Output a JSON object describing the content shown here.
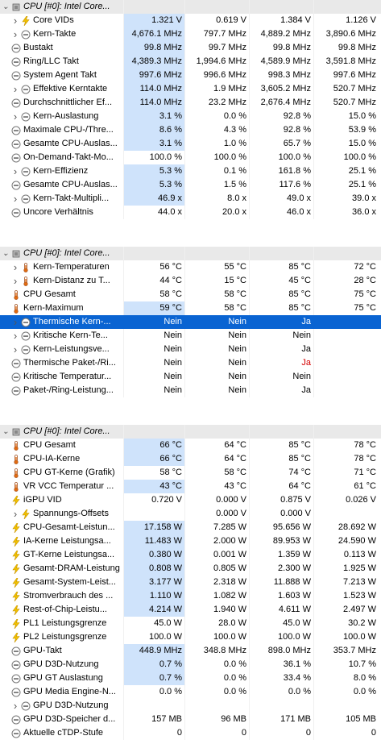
{
  "sections": [
    {
      "header": "CPU [#0]: Intel Core...",
      "rows": [
        {
          "label": "Core VIDs",
          "icon": "bolt-icon",
          "indent": 1,
          "expand": true,
          "v": [
            "1.321 V",
            "0.619 V",
            "1.384 V",
            "1.126 V"
          ],
          "hl": true
        },
        {
          "label": "Kern-Takte",
          "icon": "circle-minus-icon",
          "indent": 1,
          "expand": true,
          "v": [
            "4,676.1 MHz",
            "797.7 MHz",
            "4,889.2 MHz",
            "3,890.6 MHz"
          ],
          "hl": true
        },
        {
          "label": "Bustakt",
          "icon": "circle-minus-icon",
          "indent": 0,
          "expand": false,
          "v": [
            "99.8 MHz",
            "99.7 MHz",
            "99.8 MHz",
            "99.8 MHz"
          ],
          "hl": true
        },
        {
          "label": "Ring/LLC Takt",
          "icon": "circle-minus-icon",
          "indent": 0,
          "expand": false,
          "v": [
            "4,389.3 MHz",
            "1,994.6 MHz",
            "4,589.9 MHz",
            "3,591.8 MHz"
          ],
          "hl": true
        },
        {
          "label": "System Agent Takt",
          "icon": "circle-minus-icon",
          "indent": 0,
          "expand": false,
          "v": [
            "997.6 MHz",
            "996.6 MHz",
            "998.3 MHz",
            "997.6 MHz"
          ],
          "hl": true
        },
        {
          "label": "Effektive Kerntakte",
          "icon": "circle-minus-icon",
          "indent": 1,
          "expand": true,
          "v": [
            "114.0 MHz",
            "1.9 MHz",
            "3,605.2 MHz",
            "520.7 MHz"
          ],
          "hl": true
        },
        {
          "label": "Durchschnittlicher Ef...",
          "icon": "circle-minus-icon",
          "indent": 0,
          "expand": false,
          "v": [
            "114.0 MHz",
            "23.2 MHz",
            "2,676.4 MHz",
            "520.7 MHz"
          ],
          "hl": true
        },
        {
          "label": "Kern-Auslastung",
          "icon": "circle-minus-icon",
          "indent": 1,
          "expand": true,
          "v": [
            "3.1 %",
            "0.0 %",
            "92.8 %",
            "15.0 %"
          ],
          "hl": true
        },
        {
          "label": "Maximale CPU-/Thre...",
          "icon": "circle-minus-icon",
          "indent": 0,
          "expand": false,
          "v": [
            "8.6 %",
            "4.3 %",
            "92.8 %",
            "53.9 %"
          ],
          "hl": true
        },
        {
          "label": "Gesamte CPU-Auslas...",
          "icon": "circle-minus-icon",
          "indent": 0,
          "expand": false,
          "v": [
            "3.1 %",
            "1.0 %",
            "65.7 %",
            "15.0 %"
          ],
          "hl": true
        },
        {
          "label": "On-Demand-Takt-Mo...",
          "icon": "circle-minus-icon",
          "indent": 0,
          "expand": false,
          "v": [
            "100.0 %",
            "100.0 %",
            "100.0 %",
            "100.0 %"
          ],
          "hl": false
        },
        {
          "label": "Kern-Effizienz",
          "icon": "circle-minus-icon",
          "indent": 1,
          "expand": true,
          "v": [
            "5.3 %",
            "0.1 %",
            "161.8 %",
            "25.1 %"
          ],
          "hl": true
        },
        {
          "label": "Gesamte CPU-Auslas...",
          "icon": "circle-minus-icon",
          "indent": 0,
          "expand": false,
          "v": [
            "5.3 %",
            "1.5 %",
            "117.6 %",
            "25.1 %"
          ],
          "hl": true
        },
        {
          "label": "Kern-Takt-Multipli...",
          "icon": "circle-minus-icon",
          "indent": 1,
          "expand": true,
          "v": [
            "46.9 x",
            "8.0 x",
            "49.0 x",
            "39.0 x"
          ],
          "hl": true
        },
        {
          "label": "Uncore Verhältnis",
          "icon": "circle-minus-icon",
          "indent": 0,
          "expand": false,
          "v": [
            "44.0 x",
            "20.0 x",
            "46.0 x",
            "36.0 x"
          ],
          "hl": false
        }
      ]
    },
    {
      "header": "CPU [#0]: Intel Core...",
      "rows": [
        {
          "label": "Kern-Temperaturen",
          "icon": "thermometer-icon",
          "indent": 1,
          "expand": true,
          "v": [
            "56 °C",
            "55 °C",
            "85 °C",
            "72 °C"
          ],
          "hl": false
        },
        {
          "label": "Kern-Distanz zu T...",
          "icon": "thermometer-icon",
          "indent": 1,
          "expand": true,
          "v": [
            "44 °C",
            "15 °C",
            "45 °C",
            "28 °C"
          ],
          "hl": false
        },
        {
          "label": "CPU Gesamt",
          "icon": "thermometer-icon",
          "indent": 0,
          "expand": false,
          "v": [
            "58 °C",
            "58 °C",
            "85 °C",
            "75 °C"
          ],
          "hl": false
        },
        {
          "label": "Kern-Maximum",
          "icon": "thermometer-icon",
          "indent": 0,
          "expand": false,
          "v": [
            "59 °C",
            "58 °C",
            "85 °C",
            "75 °C"
          ],
          "hl": true
        },
        {
          "label": "Thermische Kern-...",
          "icon": "circle-minus-icon",
          "indent": 1,
          "expand": true,
          "v": [
            "Nein",
            "Nein",
            "Ja",
            ""
          ],
          "hl": false,
          "selected": true
        },
        {
          "label": "Kritische Kern-Te...",
          "icon": "circle-minus-icon",
          "indent": 1,
          "expand": true,
          "v": [
            "Nein",
            "Nein",
            "Nein",
            ""
          ],
          "hl": false
        },
        {
          "label": "Kern-Leistungsve...",
          "icon": "circle-minus-icon",
          "indent": 1,
          "expand": true,
          "v": [
            "Nein",
            "Nein",
            "Ja",
            ""
          ],
          "hl": false
        },
        {
          "label": "Thermische Paket-/Ri...",
          "icon": "circle-minus-icon",
          "indent": 0,
          "expand": false,
          "v": [
            "Nein",
            "Nein",
            "Ja",
            ""
          ],
          "hl": false,
          "red3": true
        },
        {
          "label": "Kritische Temperatur...",
          "icon": "circle-minus-icon",
          "indent": 0,
          "expand": false,
          "v": [
            "Nein",
            "Nein",
            "Nein",
            ""
          ],
          "hl": false
        },
        {
          "label": "Paket-/Ring-Leistung...",
          "icon": "circle-minus-icon",
          "indent": 0,
          "expand": false,
          "v": [
            "Nein",
            "Nein",
            "Ja",
            ""
          ],
          "hl": false
        }
      ]
    },
    {
      "header": "CPU [#0]: Intel Core...",
      "rows": [
        {
          "label": "CPU Gesamt",
          "icon": "thermometer-icon",
          "indent": 0,
          "expand": false,
          "v": [
            "66 °C",
            "64 °C",
            "85 °C",
            "78 °C"
          ],
          "hl": true
        },
        {
          "label": "CPU-IA-Kerne",
          "icon": "thermometer-icon",
          "indent": 0,
          "expand": false,
          "v": [
            "66 °C",
            "64 °C",
            "85 °C",
            "78 °C"
          ],
          "hl": true
        },
        {
          "label": "CPU GT-Kerne (Grafik)",
          "icon": "thermometer-icon",
          "indent": 0,
          "expand": false,
          "v": [
            "58 °C",
            "58 °C",
            "74 °C",
            "71 °C"
          ],
          "hl": false
        },
        {
          "label": "VR VCC Temperatur ...",
          "icon": "thermometer-icon",
          "indent": 0,
          "expand": false,
          "v": [
            "43 °C",
            "43 °C",
            "64 °C",
            "61 °C"
          ],
          "hl": true
        },
        {
          "label": "iGPU VID",
          "icon": "bolt-icon",
          "indent": 0,
          "expand": false,
          "v": [
            "0.720 V",
            "0.000 V",
            "0.875 V",
            "0.026 V"
          ],
          "hl": false
        },
        {
          "label": "Spannungs-Offsets",
          "icon": "bolt-icon",
          "indent": 1,
          "expand": true,
          "v": [
            "",
            "0.000 V",
            "0.000 V",
            ""
          ],
          "hl": false
        },
        {
          "label": "CPU-Gesamt-Leistun...",
          "icon": "bolt-icon",
          "indent": 0,
          "expand": false,
          "v": [
            "17.158 W",
            "7.285 W",
            "95.656 W",
            "28.692 W"
          ],
          "hl": true
        },
        {
          "label": "IA-Kerne Leistungsa...",
          "icon": "bolt-icon",
          "indent": 0,
          "expand": false,
          "v": [
            "11.483 W",
            "2.000 W",
            "89.953 W",
            "24.590 W"
          ],
          "hl": true
        },
        {
          "label": "GT-Kerne Leistungsa...",
          "icon": "bolt-icon",
          "indent": 0,
          "expand": false,
          "v": [
            "0.380 W",
            "0.001 W",
            "1.359 W",
            "0.113 W"
          ],
          "hl": true
        },
        {
          "label": "Gesamt-DRAM-Leistung",
          "icon": "bolt-icon",
          "indent": 0,
          "expand": false,
          "v": [
            "0.808 W",
            "0.805 W",
            "2.300 W",
            "1.925 W"
          ],
          "hl": true
        },
        {
          "label": "Gesamt-System-Leist...",
          "icon": "bolt-icon",
          "indent": 0,
          "expand": false,
          "v": [
            "3.177 W",
            "2.318 W",
            "11.888 W",
            "7.213 W"
          ],
          "hl": true
        },
        {
          "label": "Stromverbrauch des ...",
          "icon": "bolt-icon",
          "indent": 0,
          "expand": false,
          "v": [
            "1.110 W",
            "1.082 W",
            "1.603 W",
            "1.523 W"
          ],
          "hl": true
        },
        {
          "label": "Rest-of-Chip-Leistu...",
          "icon": "bolt-icon",
          "indent": 0,
          "expand": false,
          "v": [
            "4.214 W",
            "1.940 W",
            "4.611 W",
            "2.497 W"
          ],
          "hl": true
        },
        {
          "label": "PL1 Leistungsgrenze",
          "icon": "bolt-icon",
          "indent": 0,
          "expand": false,
          "v": [
            "45.0 W",
            "28.0 W",
            "45.0 W",
            "30.2 W"
          ],
          "hl": false
        },
        {
          "label": "PL2 Leistungsgrenze",
          "icon": "bolt-icon",
          "indent": 0,
          "expand": false,
          "v": [
            "100.0 W",
            "100.0 W",
            "100.0 W",
            "100.0 W"
          ],
          "hl": false
        },
        {
          "label": "GPU-Takt",
          "icon": "circle-minus-icon",
          "indent": 0,
          "expand": false,
          "v": [
            "448.9 MHz",
            "348.8 MHz",
            "898.0 MHz",
            "353.7 MHz"
          ],
          "hl": true
        },
        {
          "label": "GPU D3D-Nutzung",
          "icon": "circle-minus-icon",
          "indent": 0,
          "expand": false,
          "v": [
            "0.7 %",
            "0.0 %",
            "36.1 %",
            "10.7 %"
          ],
          "hl": true
        },
        {
          "label": "GPU GT Auslastung",
          "icon": "circle-minus-icon",
          "indent": 0,
          "expand": false,
          "v": [
            "0.7 %",
            "0.0 %",
            "33.4 %",
            "8.0 %"
          ],
          "hl": true
        },
        {
          "label": "GPU Media Engine-N...",
          "icon": "circle-minus-icon",
          "indent": 0,
          "expand": false,
          "v": [
            "0.0 %",
            "0.0 %",
            "0.0 %",
            "0.0 %"
          ],
          "hl": false
        },
        {
          "label": "GPU D3D-Nutzung",
          "icon": "circle-minus-icon",
          "indent": 1,
          "expand": true,
          "v": [
            "",
            "",
            "",
            ""
          ],
          "hl": false
        },
        {
          "label": "GPU D3D-Speicher d...",
          "icon": "circle-minus-icon",
          "indent": 0,
          "expand": false,
          "v": [
            "157 MB",
            "96 MB",
            "171 MB",
            "105 MB"
          ],
          "hl": false
        },
        {
          "label": "Aktuelle cTDP-Stufe",
          "icon": "circle-minus-icon",
          "indent": 0,
          "expand": false,
          "v": [
            "0",
            "0",
            "0",
            "0"
          ],
          "hl": false
        }
      ]
    }
  ],
  "colors": {
    "highlight": "#cfe3fb",
    "selected": "#0a64d2",
    "header": "#e9e9e9",
    "alert": "#d40000",
    "bolt": "#e7b200",
    "thermo": "#d07020"
  }
}
